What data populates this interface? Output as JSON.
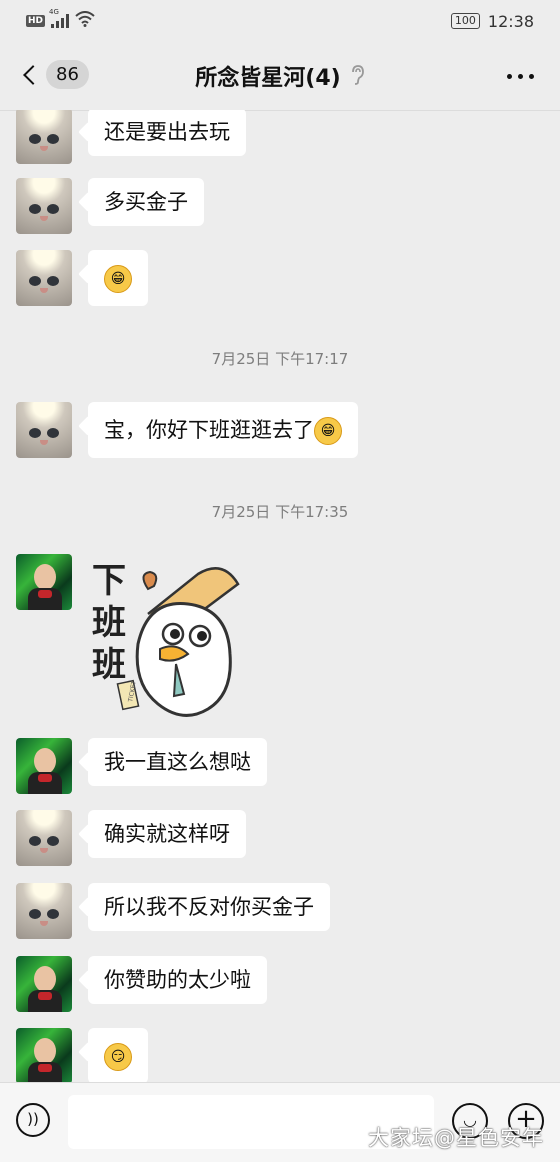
{
  "status": {
    "network_badge": "HD",
    "signal_gen": "4G",
    "battery": "100",
    "time": "12:38"
  },
  "nav": {
    "unread_count": "86",
    "title": "所念皆星河(4)",
    "ear_icon": "ear-icon",
    "more_icon": "more-icon"
  },
  "messages": [
    {
      "type": "text",
      "avatar": "cat",
      "text": "还是要出去玩"
    },
    {
      "type": "text",
      "avatar": "cat",
      "text": "多买金子"
    },
    {
      "type": "emoji",
      "avatar": "cat",
      "emoji": "grin-emoji"
    },
    {
      "type": "time",
      "text": "7月25日 下午17:17"
    },
    {
      "type": "text",
      "avatar": "cat",
      "text": "宝，你好下班逛逛去了",
      "emoji": "grin-emoji"
    },
    {
      "type": "time",
      "text": "7月25日 下午17:35"
    },
    {
      "type": "sticker",
      "avatar": "girl",
      "sticker_text": "下班班",
      "sticker_tag": "TICKET"
    },
    {
      "type": "text",
      "avatar": "girl",
      "text": "我一直这么想哒"
    },
    {
      "type": "text",
      "avatar": "cat",
      "text": "确实就这样呀"
    },
    {
      "type": "text",
      "avatar": "cat",
      "text": "所以我不反对你买金子"
    },
    {
      "type": "text",
      "avatar": "girl",
      "text": "你赞助的太少啦"
    },
    {
      "type": "emoji",
      "avatar": "girl",
      "emoji": "smirk-emoji"
    }
  ],
  "input": {
    "voice_icon": "voice-icon",
    "emoji_icon": "emoji-icon",
    "plus_icon": "plus-icon"
  },
  "watermark": "大家坛@星色安年"
}
